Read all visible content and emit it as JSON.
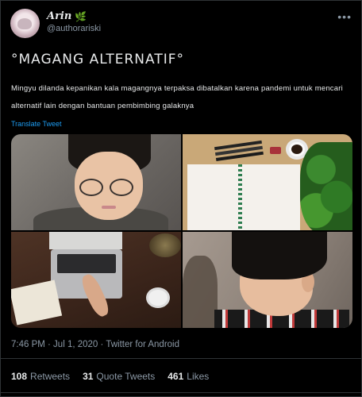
{
  "author": {
    "display_name": "Arin",
    "handle": "@authorariski",
    "badge_icon": "leaf-icon"
  },
  "tweet": {
    "headline": "°MAGANG ALTERNATIF°",
    "body": "Mingyu dilanda kepanikan kala magangnya terpaksa dibatalkan karena  pandemi untuk mencari alternatif lain dengan bantuan pembimbing galaknya",
    "translate_label": "Translate Tweet",
    "timestamp": "7:46 PM · Jul 1, 2020 · Twitter for Android"
  },
  "media": [
    {
      "name": "photo-man-glasses"
    },
    {
      "name": "photo-desk-notebook"
    },
    {
      "name": "photo-laptop-desk"
    },
    {
      "name": "photo-man-profile"
    }
  ],
  "stats": {
    "retweets_count": "108",
    "retweets_label": "Retweets",
    "quotes_count": "31",
    "quotes_label": "Quote Tweets",
    "likes_count": "461",
    "likes_label": "Likes"
  },
  "colors": {
    "background": "#000000",
    "link": "#1d9bf0",
    "secondary_text": "#8b98a5"
  }
}
